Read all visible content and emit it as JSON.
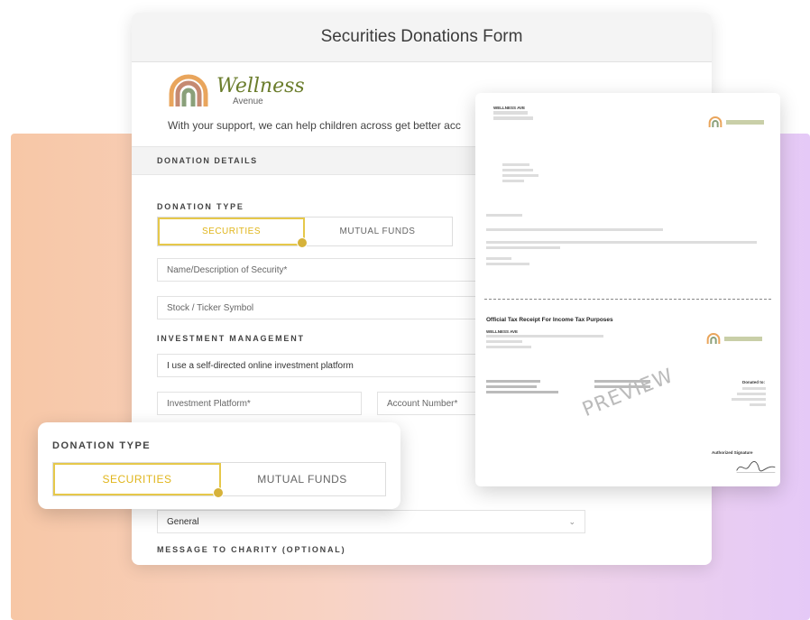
{
  "form": {
    "title": "Securities Donations Form",
    "logo": {
      "name": "Wellness",
      "sub": "Avenue"
    },
    "tagline": "With your support, we can help children across get better acc",
    "section_header": "DONATION DETAILS",
    "donation_type_label": "DONATION TYPE",
    "donation_type_options": [
      "SECURITIES",
      "MUTUAL FUNDS"
    ],
    "donation_type_selected": "SECURITIES",
    "security_name_placeholder": "Name/Description of Security*",
    "ticker_placeholder": "Stock / Ticker Symbol",
    "investment_management_label": "INVESTMENT MANAGEMENT",
    "investment_management_value": "I use a self-directed online investment platform",
    "investment_platform_placeholder": "Investment Platform*",
    "account_number_placeholder": "Account Number*",
    "fund_select_value": "General",
    "message_label": "MESSAGE TO CHARITY (OPTIONAL)"
  },
  "overlay": {
    "label": "DONATION TYPE",
    "options": [
      "SECURITIES",
      "MUTUAL FUNDS"
    ],
    "selected": "SECURITIES"
  },
  "preview": {
    "org_name": "WELLNESS AVE",
    "receipt_title": "Official Tax Receipt For Income Tax Purposes",
    "watermark": "PREVIEW",
    "donated_to_label": "Donated to:",
    "signature_label": "Authorized Signature"
  },
  "colors": {
    "accent_yellow": "#e6c84a",
    "logo_green": "#6b7d2c",
    "bg_gradient_left": "#f7c7a6",
    "bg_gradient_right": "#e5c9f7"
  }
}
